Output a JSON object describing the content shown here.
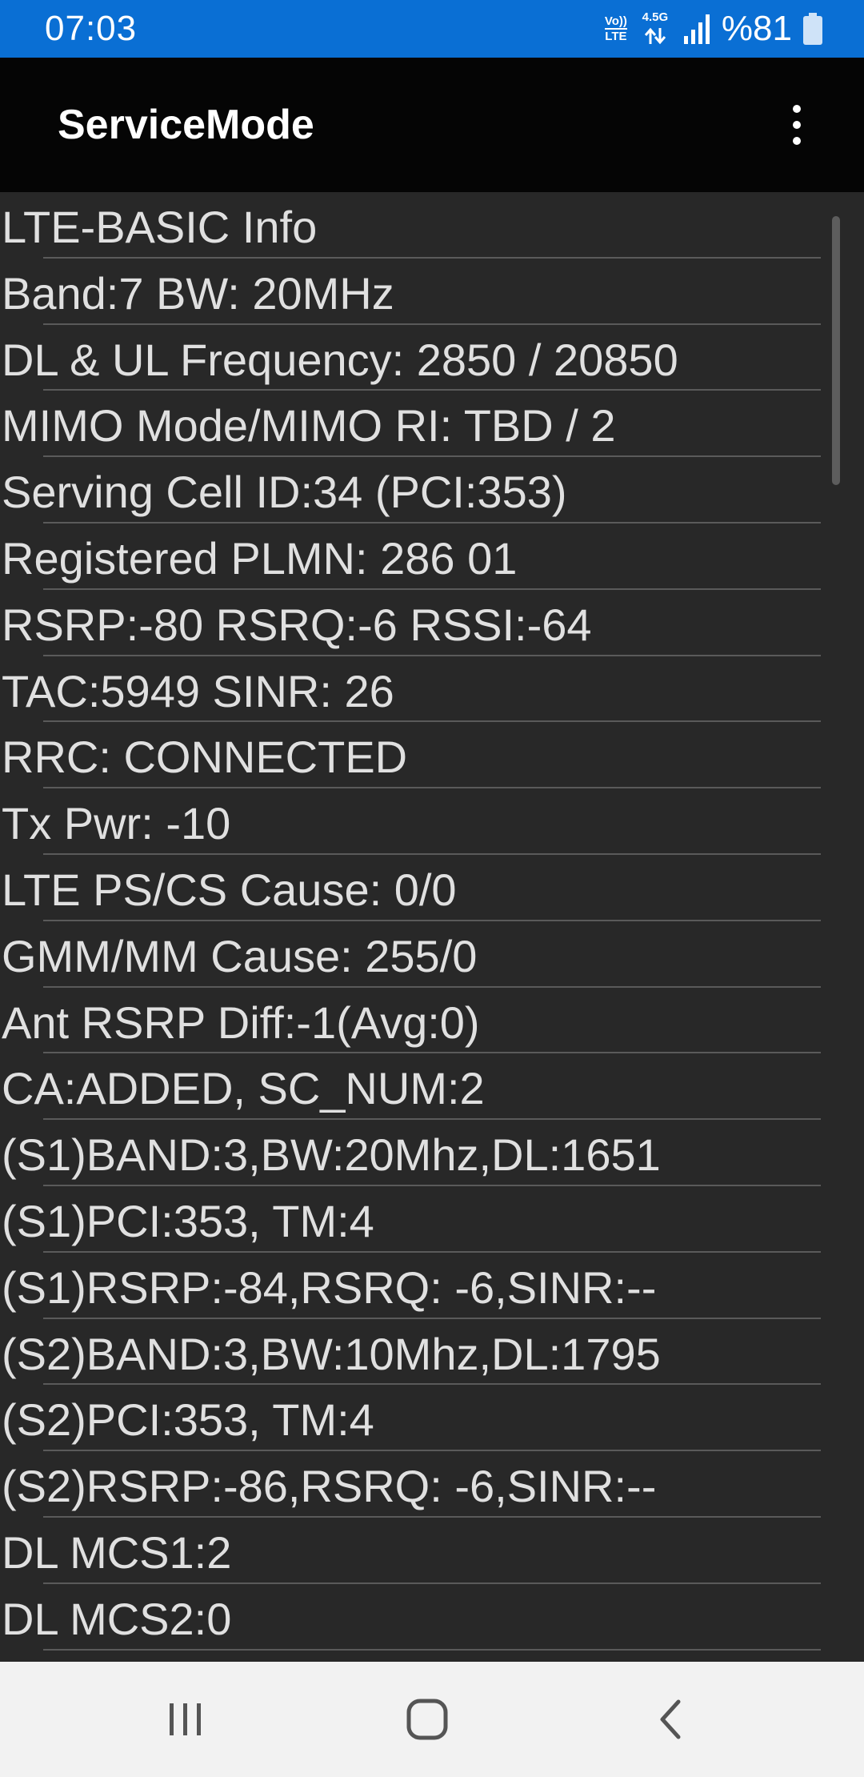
{
  "status_bar": {
    "time": "07:03",
    "volte_top": "Vo))",
    "volte_bottom": "LTE",
    "network_type": "4.5G",
    "battery_percent": "%81",
    "icons": [
      "volte-icon",
      "data-activity-icon",
      "signal-icon",
      "battery-icon"
    ]
  },
  "app_bar": {
    "title": "ServiceMode",
    "menu_icon": "more-vert-icon"
  },
  "info_rows": [
    "LTE-BASIC Info",
    "Band:7 BW: 20MHz",
    "DL & UL Frequency: 2850 / 20850",
    "MIMO Mode/MIMO RI: TBD / 2",
    "Serving Cell ID:34 (PCI:353)",
    "Registered PLMN: 286 01",
    "RSRP:-80 RSRQ:-6 RSSI:-64",
    "TAC:5949 SINR: 26",
    "RRC: CONNECTED",
    "Tx Pwr: -10",
    "LTE PS/CS Cause: 0/0",
    "GMM/MM Cause: 255/0",
    "Ant RSRP Diff:-1(Avg:0)",
    "CA:ADDED, SC_NUM:2",
    "(S1)BAND:3,BW:20Mhz,DL:1651",
    "(S1)PCI:353, TM:4",
    "(S1)RSRP:-84,RSRQ: -6,SINR:--",
    "(S2)BAND:3,BW:10Mhz,DL:1795",
    "(S2)PCI:353, TM:4",
    "(S2)RSRP:-86,RSRQ: -6,SINR:--",
    "DL MCS1:2",
    "DL MCS2:0"
  ],
  "nav_bar": {
    "icons": [
      "recents-icon",
      "home-icon",
      "back-icon"
    ]
  },
  "colors": {
    "status_bar": "#0a6fd4",
    "app_bar": "#050505",
    "list_background": "#282828",
    "list_text": "#e0e0e0",
    "nav_bar": "#f2f2f2"
  }
}
